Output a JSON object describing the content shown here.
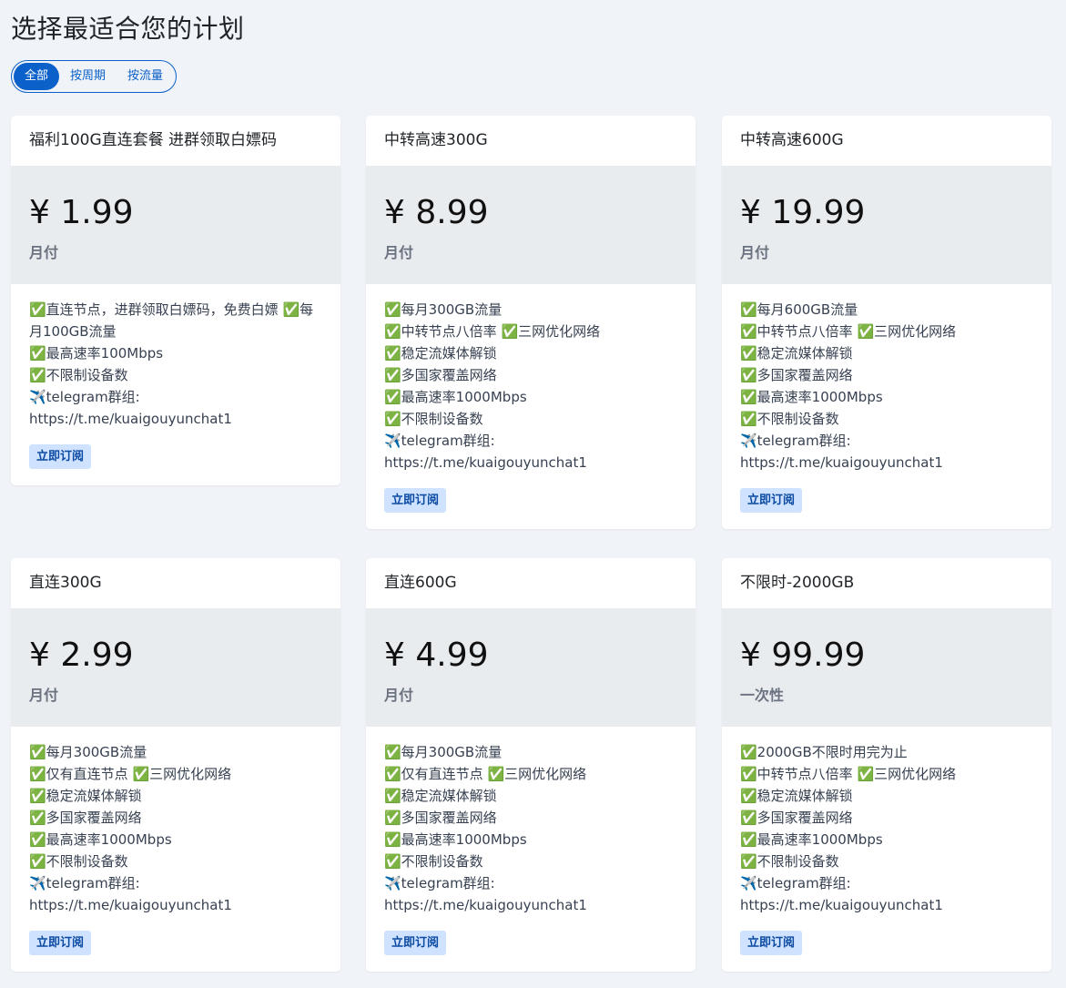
{
  "page": {
    "title": "选择最适合您的计划"
  },
  "filters": {
    "tabs": [
      {
        "label": "全部",
        "active": true
      },
      {
        "label": "按周期",
        "active": false
      },
      {
        "label": "按流量",
        "active": false
      }
    ]
  },
  "plans": [
    {
      "name": "福利100G直连套餐 进群领取白嫖码",
      "price": "¥ 1.99",
      "cycle": "月付",
      "features": "✅直连节点，进群领取白嫖码，免费白嫖 ✅每月100GB流量\n✅最高速率100Mbps\n✅不限制设备数\n✈️telegram群组:\nhttps://t.me/kuaigouyunchat1",
      "button": "立即订阅"
    },
    {
      "name": "中转高速300G",
      "price": "¥ 8.99",
      "cycle": "月付",
      "features": "✅每月300GB流量\n✅中转节点八倍率 ✅三网优化网络\n✅稳定流媒体解锁\n✅多国家覆盖网络\n✅最高速率1000Mbps\n✅不限制设备数\n✈️telegram群组:\nhttps://t.me/kuaigouyunchat1",
      "button": "立即订阅"
    },
    {
      "name": "中转高速600G",
      "price": "¥ 19.99",
      "cycle": "月付",
      "features": "✅每月600GB流量\n✅中转节点八倍率 ✅三网优化网络\n✅稳定流媒体解锁\n✅多国家覆盖网络\n✅最高速率1000Mbps\n✅不限制设备数\n✈️telegram群组:\nhttps://t.me/kuaigouyunchat1",
      "button": "立即订阅"
    },
    {
      "name": "直连300G",
      "price": "¥ 2.99",
      "cycle": "月付",
      "features": "✅每月300GB流量\n✅仅有直连节点 ✅三网优化网络\n✅稳定流媒体解锁\n✅多国家覆盖网络\n✅最高速率1000Mbps\n✅不限制设备数\n✈️telegram群组:\nhttps://t.me/kuaigouyunchat1",
      "button": "立即订阅"
    },
    {
      "name": "直连600G",
      "price": "¥ 4.99",
      "cycle": "月付",
      "features": "✅每月300GB流量\n✅仅有直连节点 ✅三网优化网络\n✅稳定流媒体解锁\n✅多国家覆盖网络\n✅最高速率1000Mbps\n✅不限制设备数\n✈️telegram群组:\nhttps://t.me/kuaigouyunchat1",
      "button": "立即订阅"
    },
    {
      "name": "不限时-2000GB",
      "price": "¥ 99.99",
      "cycle": "一次性",
      "features": "✅2000GB不限时用完为止\n✅中转节点八倍率 ✅三网优化网络\n✅稳定流媒体解锁\n✅多国家覆盖网络\n✅最高速率1000Mbps\n✅不限制设备数\n✈️telegram群组:\nhttps://t.me/kuaigouyunchat1",
      "button": "立即订阅"
    }
  ],
  "colors": {
    "accent": "#0b61c9",
    "page_bg": "#f0f3f8",
    "price_bg": "#e9ecef",
    "button_bg": "#cfe2ff"
  }
}
